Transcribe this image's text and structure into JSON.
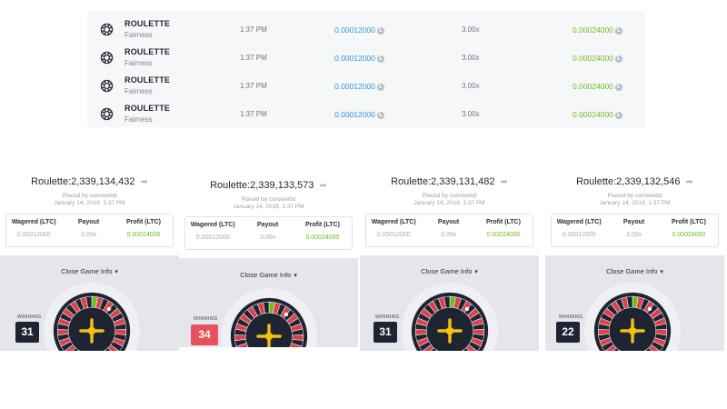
{
  "history": {
    "rows": [
      {
        "game": "ROULETTE",
        "sub": "Fairness",
        "time": "1:37 PM",
        "amount": "0.00012000",
        "payout": "3.00x",
        "profit": "0.00024000"
      },
      {
        "game": "ROULETTE",
        "sub": "Fairness",
        "time": "1:37 PM",
        "amount": "0.00012000",
        "payout": "3.00x",
        "profit": "0.00024000"
      },
      {
        "game": "ROULETTE",
        "sub": "Fairness",
        "time": "1:37 PM",
        "amount": "0.00012000",
        "payout": "3.00x",
        "profit": "0.00024000"
      },
      {
        "game": "ROULETTE",
        "sub": "Fairness",
        "time": "1:37 PM",
        "amount": "0.00012000",
        "payout": "3.00x",
        "profit": "0.00024000"
      }
    ],
    "coin_glyph": "Ł"
  },
  "cards": [
    {
      "title": "Roulette:2,339,134,432",
      "placed_by": "Placed by carolwebd",
      "date": "January 14, 2019, 1:37 PM",
      "wagered_label": "Wagered (LTC)",
      "payout_label": "Payout",
      "profit_label": "Profit (LTC)",
      "wagered": "0.00012000",
      "payout": "3.00x",
      "profit": "0.00024000",
      "close_label": "Close Game Info",
      "winning_label": "WINNING",
      "winning_number": "31",
      "winning_color": "#1f2433"
    },
    {
      "title": "Roulette:2,339,133,573",
      "placed_by": "Placed by carolwebd",
      "date": "January 14, 2019, 1:37 PM",
      "wagered_label": "Wagered (LTC)",
      "payout_label": "Payout",
      "profit_label": "Profit (LTC)",
      "wagered": "0.00012000",
      "payout": "3.00x",
      "profit": "0.00024000",
      "close_label": "Close Game Info",
      "winning_label": "WINNING",
      "winning_number": "34",
      "winning_color": "#e8505b"
    },
    {
      "title": "Roulette:2,339,131,482",
      "placed_by": "Placed by carolwebd",
      "date": "January 14, 2019, 1:37 PM",
      "wagered_label": "Wagered (LTC)",
      "payout_label": "Payout",
      "profit_label": "Profit (LTC)",
      "wagered": "0.00012000",
      "payout": "3.00x",
      "profit": "0.00024000",
      "close_label": "Close Game Info",
      "winning_label": "WINNING",
      "winning_number": "31",
      "winning_color": "#1f2433"
    },
    {
      "title": "Roulette:2,339,132,546",
      "placed_by": "Placed by carolwebd",
      "date": "January 14, 2019, 1:37 PM",
      "wagered_label": "Wagered (LTC)",
      "payout_label": "Payout",
      "profit_label": "Profit (LTC)",
      "wagered": "0.00012000",
      "payout": "3.00x",
      "profit": "0.00024000",
      "close_label": "Close Game Info",
      "winning_label": "WINNING",
      "winning_number": "22",
      "winning_color": "#1f2433"
    }
  ],
  "icons": {
    "game": "roulette-wheel-icon",
    "share": "share-arrow-icon",
    "chevron": "chevron-down-icon",
    "coin": "litecoin-icon"
  },
  "colors": {
    "amount_blue": "#2d9bd6",
    "profit_green": "#6bbf1c",
    "wheel_red": "#d9434e",
    "wheel_dark": "#1f2433",
    "hub_yellow": "#f2c20f"
  }
}
